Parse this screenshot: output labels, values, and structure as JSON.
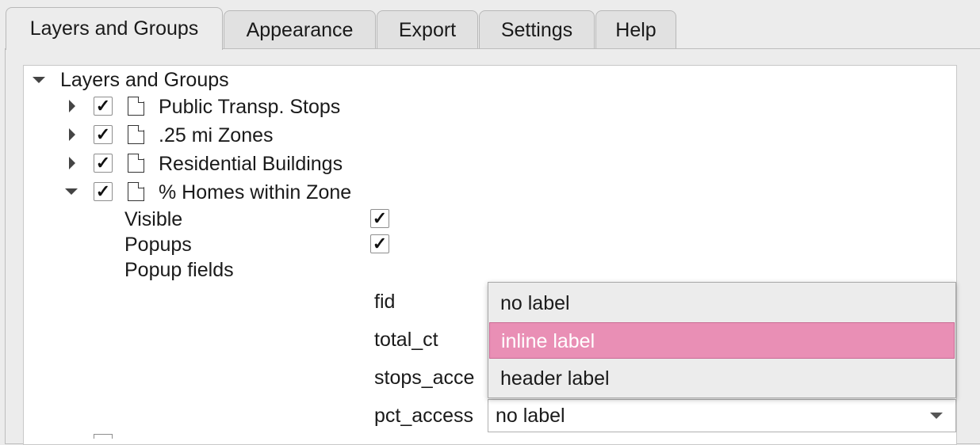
{
  "tabs": [
    {
      "label": "Layers and Groups"
    },
    {
      "label": "Appearance"
    },
    {
      "label": "Export"
    },
    {
      "label": "Settings"
    },
    {
      "label": "Help"
    }
  ],
  "tree": {
    "root_label": "Layers and Groups",
    "layers": [
      {
        "name": "Public Transp. Stops",
        "checked": true,
        "expanded": false
      },
      {
        "name": ".25 mi Zones",
        "checked": true,
        "expanded": false
      },
      {
        "name": "Residential Buildings",
        "checked": true,
        "expanded": false
      },
      {
        "name": "% Homes within Zone",
        "checked": true,
        "expanded": true
      }
    ],
    "props": {
      "visible_label": "Visible",
      "visible": true,
      "popups_label": "Popups",
      "popups": true,
      "popup_fields_label": "Popup fields"
    },
    "fields": [
      {
        "name": "fid"
      },
      {
        "name": "total_ct"
      },
      {
        "name": "stops_acce"
      },
      {
        "name": "pct_access",
        "value": "no label"
      }
    ],
    "check_glyph": "✓"
  },
  "dropdown": {
    "options": [
      "no label",
      "inline label",
      "header label"
    ],
    "selected_index": 1,
    "highlight_color": "#e98fb5"
  }
}
